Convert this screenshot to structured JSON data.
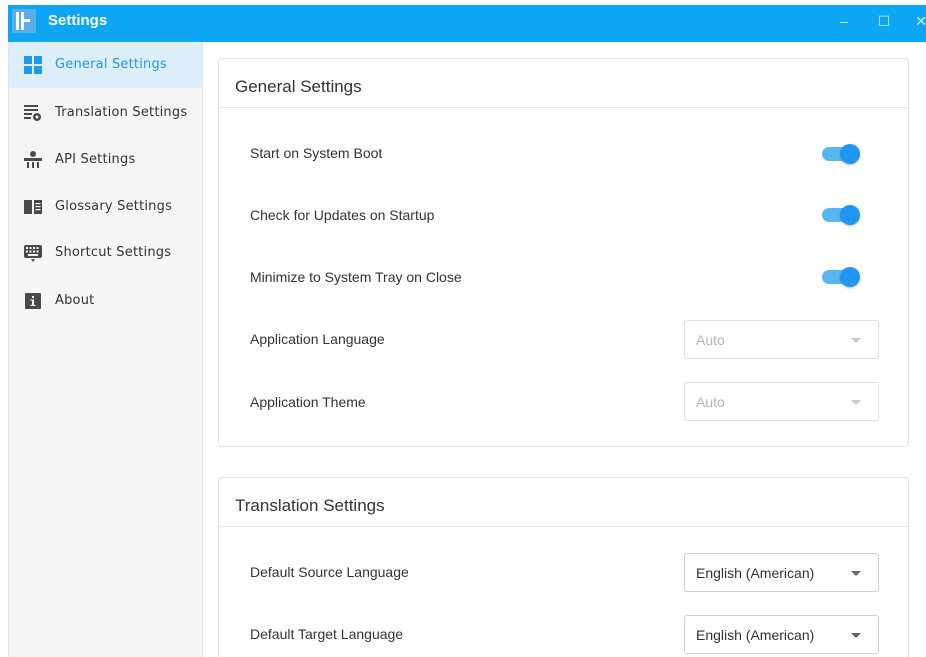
{
  "window": {
    "title": "Settings",
    "controls": {
      "minimize": "–",
      "maximize": "☐",
      "close": "✕"
    }
  },
  "colors": {
    "titlebar": "#0ea5f2",
    "accent": "#2196f3",
    "sidebar_active_bg": "#dceefa",
    "sidebar_active_text": "#2496e8"
  },
  "sidebar": {
    "items": [
      {
        "label": "General Settings",
        "icon": "grid-icon",
        "active": true
      },
      {
        "label": "Translation Settings",
        "icon": "translate-settings-icon",
        "active": false
      },
      {
        "label": "API Settings",
        "icon": "api-icon",
        "active": false
      },
      {
        "label": "Glossary Settings",
        "icon": "book-icon",
        "active": false
      },
      {
        "label": "Shortcut Settings",
        "icon": "keyboard-icon",
        "active": false
      },
      {
        "label": "About",
        "icon": "info-icon",
        "active": false
      }
    ]
  },
  "general": {
    "title": "General Settings",
    "start_on_boot": {
      "label": "Start on System Boot",
      "enabled": true
    },
    "check_updates": {
      "label": "Check for Updates on Startup",
      "enabled": true
    },
    "minimize_tray": {
      "label": "Minimize to System Tray on Close",
      "enabled": true
    },
    "language": {
      "label": "Application Language",
      "value": "Auto",
      "disabled": true
    },
    "theme": {
      "label": "Application Theme",
      "value": "Auto",
      "disabled": true
    }
  },
  "translation": {
    "title": "Translation Settings",
    "source_language": {
      "label": "Default Source Language",
      "value": "English (American)"
    },
    "target_language": {
      "label": "Default Target Language",
      "value": "English (American)"
    }
  }
}
